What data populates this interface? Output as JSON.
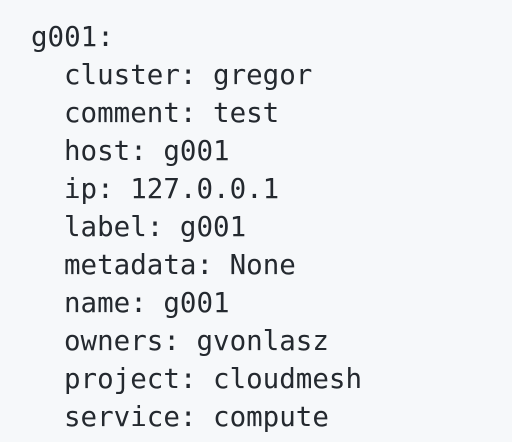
{
  "code": {
    "root": "g001:",
    "properties": [
      {
        "key": "cluster:",
        "value": "gregor"
      },
      {
        "key": "comment:",
        "value": "test"
      },
      {
        "key": "host:",
        "value": "g001"
      },
      {
        "key": "ip:",
        "value": "127.0.0.1"
      },
      {
        "key": "label:",
        "value": "g001"
      },
      {
        "key": "metadata:",
        "value": "None"
      },
      {
        "key": "name:",
        "value": "g001"
      },
      {
        "key": "owners:",
        "value": "gvonlasz"
      },
      {
        "key": "project:",
        "value": "cloudmesh"
      },
      {
        "key": "service:",
        "value": "compute"
      }
    ]
  }
}
